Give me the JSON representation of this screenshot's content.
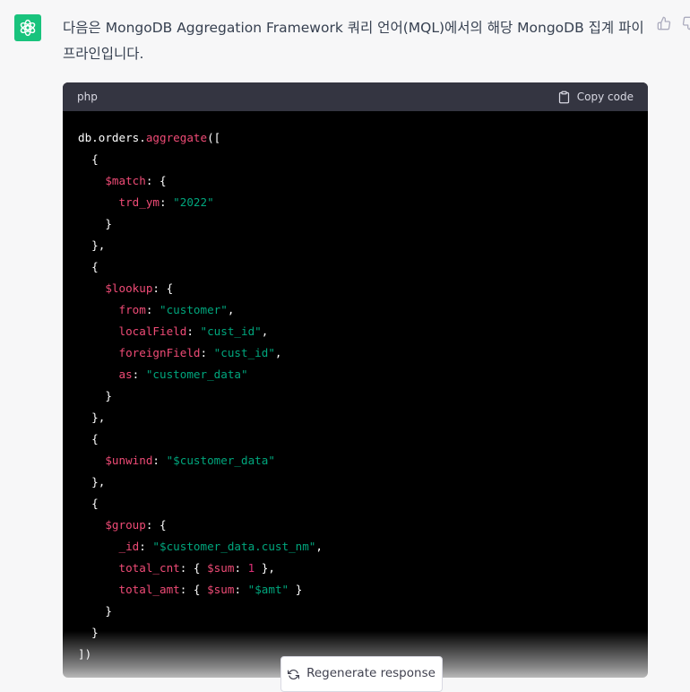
{
  "message": {
    "text": "다음은 MongoDB Aggregation Framework 쿼리 언어(MQL)에서의 해당 MongoDB 집계 파이프라인입니다."
  },
  "code_block": {
    "language": "php",
    "copy_label": "Copy code",
    "lines": [
      [
        {
          "t": "db.orders.",
          "c": "p"
        },
        {
          "t": "aggregate",
          "c": "k"
        },
        {
          "t": "([",
          "c": "p"
        }
      ],
      [
        {
          "t": "  {",
          "c": "p"
        }
      ],
      [
        {
          "t": "    ",
          "c": "p"
        },
        {
          "t": "$match",
          "c": "k"
        },
        {
          "t": ": {",
          "c": "p"
        }
      ],
      [
        {
          "t": "      ",
          "c": "p"
        },
        {
          "t": "trd_ym",
          "c": "k"
        },
        {
          "t": ": ",
          "c": "p"
        },
        {
          "t": "\"2022\"",
          "c": "s"
        }
      ],
      [
        {
          "t": "    }",
          "c": "p"
        }
      ],
      [
        {
          "t": "  },",
          "c": "p"
        }
      ],
      [
        {
          "t": "  {",
          "c": "p"
        }
      ],
      [
        {
          "t": "    ",
          "c": "p"
        },
        {
          "t": "$lookup",
          "c": "k"
        },
        {
          "t": ": {",
          "c": "p"
        }
      ],
      [
        {
          "t": "      ",
          "c": "p"
        },
        {
          "t": "from",
          "c": "k"
        },
        {
          "t": ": ",
          "c": "p"
        },
        {
          "t": "\"customer\"",
          "c": "s"
        },
        {
          "t": ",",
          "c": "p"
        }
      ],
      [
        {
          "t": "      ",
          "c": "p"
        },
        {
          "t": "localField",
          "c": "k"
        },
        {
          "t": ": ",
          "c": "p"
        },
        {
          "t": "\"cust_id\"",
          "c": "s"
        },
        {
          "t": ",",
          "c": "p"
        }
      ],
      [
        {
          "t": "      ",
          "c": "p"
        },
        {
          "t": "foreignField",
          "c": "k"
        },
        {
          "t": ": ",
          "c": "p"
        },
        {
          "t": "\"cust_id\"",
          "c": "s"
        },
        {
          "t": ",",
          "c": "p"
        }
      ],
      [
        {
          "t": "      ",
          "c": "p"
        },
        {
          "t": "as",
          "c": "k"
        },
        {
          "t": ": ",
          "c": "p"
        },
        {
          "t": "\"customer_data\"",
          "c": "s"
        }
      ],
      [
        {
          "t": "    }",
          "c": "p"
        }
      ],
      [
        {
          "t": "  },",
          "c": "p"
        }
      ],
      [
        {
          "t": "  {",
          "c": "p"
        }
      ],
      [
        {
          "t": "    ",
          "c": "p"
        },
        {
          "t": "$unwind",
          "c": "k"
        },
        {
          "t": ": ",
          "c": "p"
        },
        {
          "t": "\"$customer_data\"",
          "c": "s"
        }
      ],
      [
        {
          "t": "  },",
          "c": "p"
        }
      ],
      [
        {
          "t": "  {",
          "c": "p"
        }
      ],
      [
        {
          "t": "    ",
          "c": "p"
        },
        {
          "t": "$group",
          "c": "k"
        },
        {
          "t": ": {",
          "c": "p"
        }
      ],
      [
        {
          "t": "      ",
          "c": "p"
        },
        {
          "t": "_id",
          "c": "k"
        },
        {
          "t": ": ",
          "c": "p"
        },
        {
          "t": "\"$customer_data.cust_nm\"",
          "c": "s"
        },
        {
          "t": ",",
          "c": "p"
        }
      ],
      [
        {
          "t": "      ",
          "c": "p"
        },
        {
          "t": "total_cnt",
          "c": "k"
        },
        {
          "t": ": { ",
          "c": "p"
        },
        {
          "t": "$sum",
          "c": "k"
        },
        {
          "t": ": ",
          "c": "p"
        },
        {
          "t": "1",
          "c": "n"
        },
        {
          "t": " },",
          "c": "p"
        }
      ],
      [
        {
          "t": "      ",
          "c": "p"
        },
        {
          "t": "total_amt",
          "c": "k"
        },
        {
          "t": ": { ",
          "c": "p"
        },
        {
          "t": "$sum",
          "c": "k"
        },
        {
          "t": ": ",
          "c": "p"
        },
        {
          "t": "\"$amt\"",
          "c": "s"
        },
        {
          "t": " }",
          "c": "p"
        }
      ],
      [
        {
          "t": "    }",
          "c": "p"
        }
      ],
      [
        {
          "t": "  }",
          "c": "p"
        }
      ],
      [
        {
          "t": "])",
          "c": "p"
        }
      ]
    ]
  },
  "regenerate": {
    "label": "Regenerate response"
  },
  "icons": {
    "assistant_avatar": "openai-logo-icon",
    "copy": "clipboard-icon",
    "thumbs_up": "thumbs-up-icon",
    "thumbs_down": "thumbs-down-icon",
    "regenerate": "refresh-icon"
  },
  "colors": {
    "avatar_bg": "#19c37d",
    "code_bg": "#000000",
    "code_header_bg": "#343541",
    "keyword": "#ef4b76",
    "string": "#00a67d",
    "number": "#df3079"
  }
}
